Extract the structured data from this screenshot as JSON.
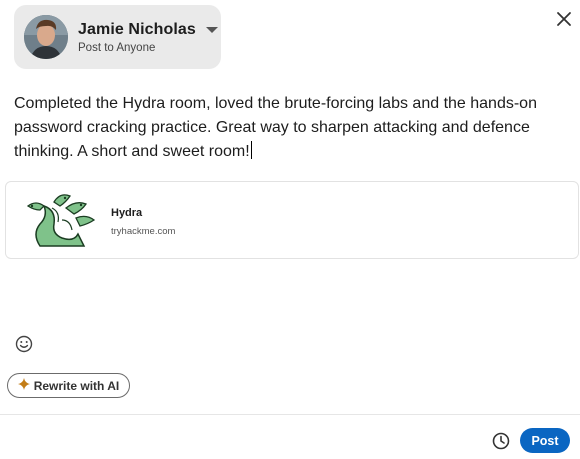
{
  "composer": {
    "author_name": "Jamie Nicholas",
    "visibility": "Post to Anyone",
    "post_text": "Completed the Hydra room, loved the brute-forcing labs and the hands-on password cracking practice. Great way to sharpen attacking and defence thinking. A short and sweet room!"
  },
  "link_preview": {
    "title": "Hydra",
    "domain": "tryhackme.com"
  },
  "toolbar": {
    "rewrite_label": "Rewrite with AI",
    "post_label": "Post"
  },
  "colors": {
    "primary": "#0a66c2",
    "identity_bg": "#eaeaea",
    "ai_spark": "#c37d16"
  },
  "icons": [
    "close-icon",
    "caret-down-icon",
    "emoji-icon",
    "sparkle-icon",
    "clock-icon"
  ]
}
